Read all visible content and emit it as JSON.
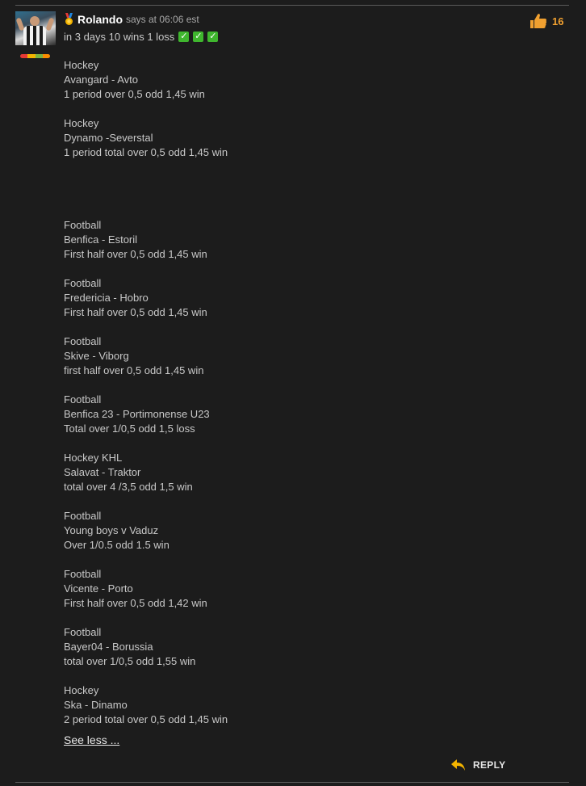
{
  "comment": {
    "username": "Rolando",
    "says_text": "says at 06:06 est",
    "summary": "in 3 days 10 wins 1 loss",
    "checkmarks": [
      "✓",
      "✓",
      "✓"
    ],
    "likes_count": "16",
    "rank_colors": [
      "#e53935",
      "#f4b400",
      "#7cb342",
      "#fb8c00"
    ],
    "tips": [
      {
        "sport": "Hockey",
        "match": "Avangard - Avto",
        "bet": "1 period over 0,5 odd 1,45 win"
      },
      {
        "sport": "Hockey",
        "match": "Dynamo -Severstal",
        "bet": "1 period total over 0,5 odd 1,45 win"
      },
      {
        "sport": "Football",
        "match": "Benfica - Estoril",
        "bet": "First half over 0,5 odd 1,45 win"
      },
      {
        "sport": "Football",
        "match": "Fredericia - Hobro",
        "bet": "First half over 0,5 odd 1,45 win"
      },
      {
        "sport": "Football",
        "match": "Skive - Viborg",
        "bet": "first half over 0,5 odd 1,45 win"
      },
      {
        "sport": "Football",
        "match": "Benfica 23 - Portimonense U23",
        "bet": "Total over 1/0,5 odd 1,5 loss"
      },
      {
        "sport": "Hockey KHL",
        "match": "Salavat - Traktor",
        "bet": "total over 4 /3,5 odd 1,5 win"
      },
      {
        "sport": "Football",
        "match": "Young boys v Vaduz",
        "bet": "Over 1/0.5 odd 1.5 win"
      },
      {
        "sport": "Football",
        "match": "Vicente - Porto",
        "bet": "First half over 0,5 odd 1,42 win"
      },
      {
        "sport": "Football",
        "match": "Bayer04 - Borussia",
        "bet": "total over 1/0,5 odd 1,55 win"
      },
      {
        "sport": "Hockey",
        "match": "Ska - Dinamo",
        "bet": "2 period total over 0,5 odd 1,45 win"
      }
    ],
    "see_less_label": "See less ...",
    "reply_label": "REPLY"
  }
}
